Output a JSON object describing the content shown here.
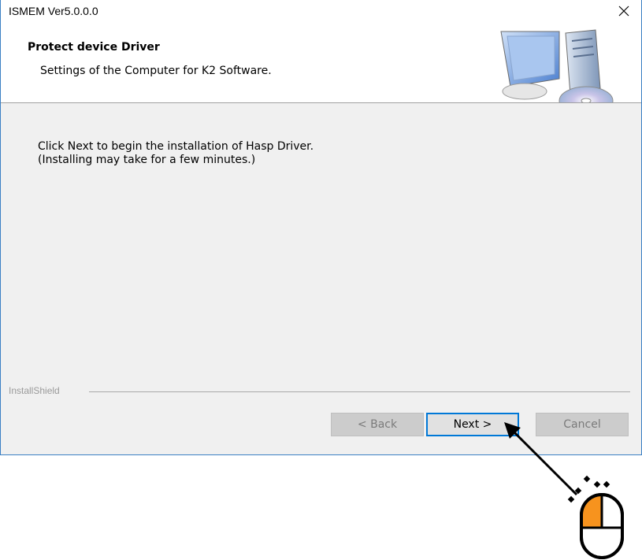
{
  "window": {
    "title": "ISMEM Ver5.0.0.0",
    "close_icon": "close-icon"
  },
  "header": {
    "title": "Protect device Driver",
    "subtitle": "Settings of the Computer for K2 Software.",
    "art_icon": "computer-icon"
  },
  "body": {
    "line1": "Click Next to begin the installation of Hasp Driver.",
    "line2": "(Installing may take for a few minutes.)"
  },
  "footer": {
    "brand": "InstallShield",
    "back_label": "< Back",
    "next_label": "Next >",
    "cancel_label": "Cancel"
  },
  "colors": {
    "accent": "#0078d7",
    "body_bg": "#f0f0f0",
    "mouse_highlight": "#f7931e"
  },
  "annotation": {
    "mouse_icon": "mouse-click-icon",
    "arrow_icon": "arrow-icon"
  }
}
